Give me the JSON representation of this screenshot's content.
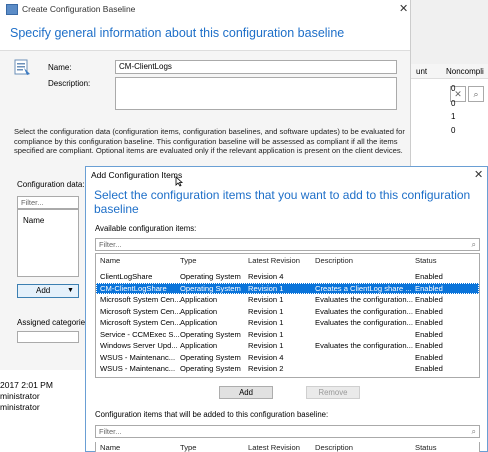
{
  "main_dialog": {
    "title": "Create Configuration Baseline",
    "close_glyph": "✕",
    "heading": "Specify general information about this configuration baseline",
    "name_label": "Name:",
    "name_value": "CM-ClientLogs",
    "description_label": "Description:",
    "description_value": "",
    "info_text": "Select the configuration data (configuration items, configuration baselines, and software updates) to be evaluated for compliance by this configuration baseline. This configuration baseline will be assessed as compliant if all the items specified are compliant. Optional items are evaluated only if the relevant application is present on  the client devices.",
    "config_data_label": "Configuration data:",
    "filter_placeholder": "Filter...",
    "list_header": "Name",
    "add_button": "Add",
    "add_arrow": "▼",
    "assigned_label": "Assigned categories"
  },
  "background_window": {
    "col_count": "unt",
    "col_noncompliant": "Noncompli",
    "noncompliant_values": [
      "0",
      "0",
      "1",
      "0"
    ]
  },
  "under_text": {
    "line1": "2017 2:01 PM",
    "line2": "ministrator",
    "line3": "ministrator"
  },
  "add_items_dialog": {
    "title": "Add Configuration Items",
    "close_glyph": "✕",
    "heading": "Select the configuration items that you want to add to this configuration baseline",
    "available_label": "Available configuration items:",
    "filter_placeholder": "Filter...",
    "columns": [
      "Name",
      "Type",
      "Latest Revision",
      "Description",
      "Status"
    ],
    "rows": [
      {
        "name": "ClientLogShare",
        "type": "Operating System",
        "revision": "Revision 4",
        "description": "",
        "status": "Enabled"
      },
      {
        "name": "CM-ClientLogShare",
        "type": "Operating System",
        "revision": "Revision 1",
        "description": "Creates a ClientLog share ...",
        "status": "Enabled"
      },
      {
        "name": "Microsoft System Cen...",
        "type": "Application",
        "revision": "Revision 1",
        "description": "Evaluates the configuration...",
        "status": "Enabled"
      },
      {
        "name": "Microsoft System Cen...",
        "type": "Application",
        "revision": "Revision 1",
        "description": "Evaluates the configuration...",
        "status": "Enabled"
      },
      {
        "name": "Microsoft System Cen...",
        "type": "Application",
        "revision": "Revision 1",
        "description": "Evaluates the configuration...",
        "status": "Enabled"
      },
      {
        "name": "Service - CCMExec S...",
        "type": "Operating System",
        "revision": "Revision 1",
        "description": "",
        "status": "Enabled"
      },
      {
        "name": "Windows Server Upd...",
        "type": "Application",
        "revision": "Revision 1",
        "description": "Evaluates the configuration...",
        "status": "Enabled"
      },
      {
        "name": "WSUS - Maintenanc...",
        "type": "Operating System",
        "revision": "Revision 4",
        "description": "",
        "status": "Enabled"
      },
      {
        "name": "WSUS - Maintenanc...",
        "type": "Operating System",
        "revision": "Revision 2",
        "description": "",
        "status": "Enabled"
      }
    ],
    "selected_index": 1,
    "add_button": "Add",
    "remove_button": "Remove",
    "added_label": "Configuration items that will be added to this configuration baseline:",
    "added_columns": [
      "Name",
      "Type",
      "Latest Revision",
      "Description",
      "Status"
    ]
  },
  "colors": {
    "accent": "#1e6fc8",
    "selection": "#0a74da"
  }
}
